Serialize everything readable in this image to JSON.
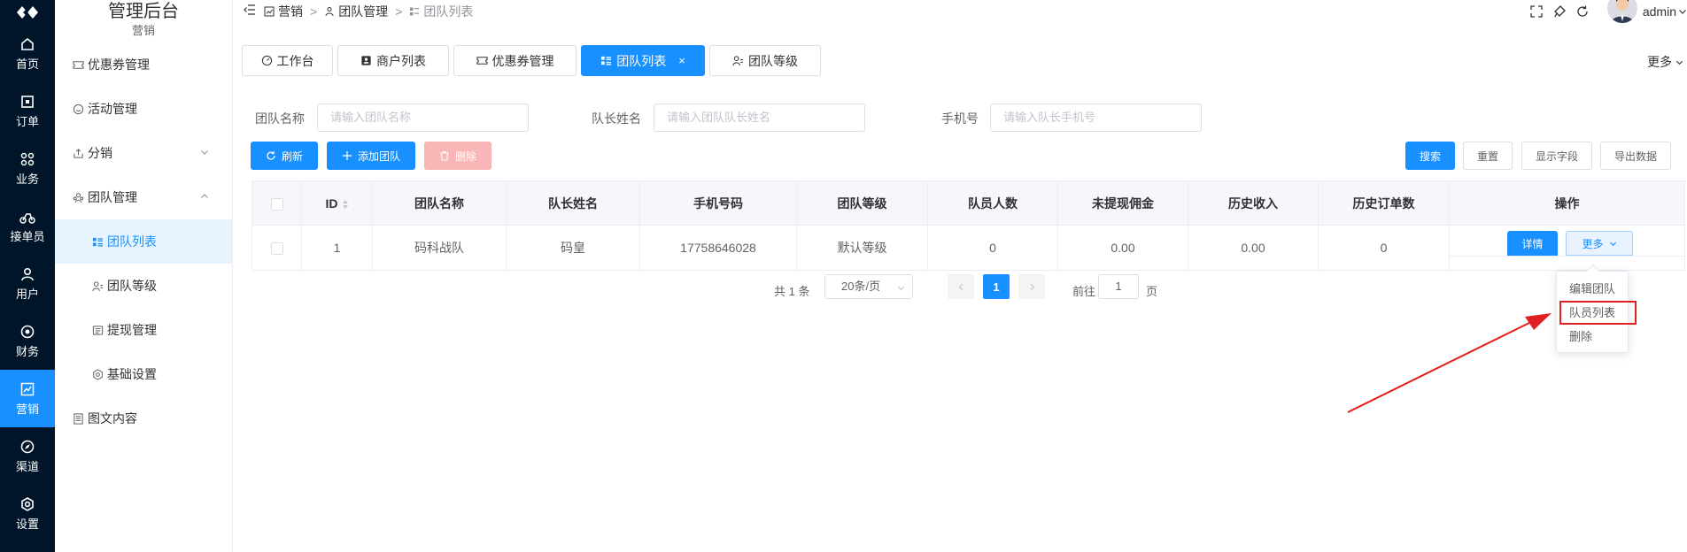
{
  "rail": [
    {
      "label": "首页",
      "icon": "home-icon"
    },
    {
      "label": "订单",
      "icon": "order-icon"
    },
    {
      "label": "业务",
      "icon": "business-icon"
    },
    {
      "label": "接单员",
      "icon": "courier-icon"
    },
    {
      "label": "用户",
      "icon": "user-icon"
    },
    {
      "label": "财务",
      "icon": "finance-icon"
    },
    {
      "label": "营销",
      "icon": "marketing-icon",
      "active": true
    },
    {
      "label": "渠道",
      "icon": "channel-icon"
    },
    {
      "label": "设置",
      "icon": "settings-icon"
    }
  ],
  "sidebar": {
    "title": "管理后台",
    "subtitle": "营销",
    "items": [
      {
        "label": "优惠券管理",
        "icon": "coupon-icon"
      },
      {
        "label": "活动管理",
        "icon": "activity-icon"
      },
      {
        "label": "分销",
        "icon": "share-icon"
      },
      {
        "label": "团队管理",
        "icon": "team-icon"
      },
      {
        "label": "团队列表",
        "icon": "list-icon"
      },
      {
        "label": "团队等级",
        "icon": "level-icon"
      },
      {
        "label": "提现管理",
        "icon": "withdraw-icon"
      },
      {
        "label": "基础设置",
        "icon": "gear-icon"
      },
      {
        "label": "图文内容",
        "icon": "document-icon"
      }
    ]
  },
  "breadcrumb": [
    "营销",
    "团队管理",
    "团队列表"
  ],
  "header": {
    "username": "admin"
  },
  "tabs": [
    {
      "label": "工作台"
    },
    {
      "label": "商户列表"
    },
    {
      "label": "优惠券管理"
    },
    {
      "label": "团队列表",
      "close": "×"
    },
    {
      "label": "团队等级"
    }
  ],
  "tabs_more": "更多",
  "filters": {
    "team_name": {
      "label": "团队名称",
      "placeholder": "请输入团队名称"
    },
    "leader_name": {
      "label": "队长姓名",
      "placeholder": "请输入团队队长姓名"
    },
    "phone": {
      "label": "手机号",
      "placeholder": "请输入队长手机号"
    }
  },
  "toolbar": {
    "refresh": "刷新",
    "add": "添加团队",
    "delete": "删除",
    "search": "搜索",
    "reset": "重置",
    "columns": "显示字段",
    "export": "导出数据"
  },
  "table": {
    "headers": [
      "ID",
      "团队名称",
      "队长姓名",
      "手机号码",
      "团队等级",
      "队员人数",
      "未提现佣金",
      "历史收入",
      "历史订单数",
      "操作"
    ],
    "rows": [
      {
        "id": "1",
        "name": "码科战队",
        "leader": "码皇",
        "phone": "17758646028",
        "level": "默认等级",
        "members": "0",
        "unwithdrawn": "0.00",
        "income": "0.00",
        "orders": "0"
      }
    ],
    "detail_label": "详情",
    "more_label": "更多"
  },
  "pagination": {
    "total": "共 1 条",
    "page_size": "20条/页",
    "current": "1",
    "goto_prefix": "前往",
    "goto_value": "1",
    "goto_suffix": "页"
  },
  "dropdown": [
    "编辑团队",
    "队员列表",
    "删除"
  ]
}
